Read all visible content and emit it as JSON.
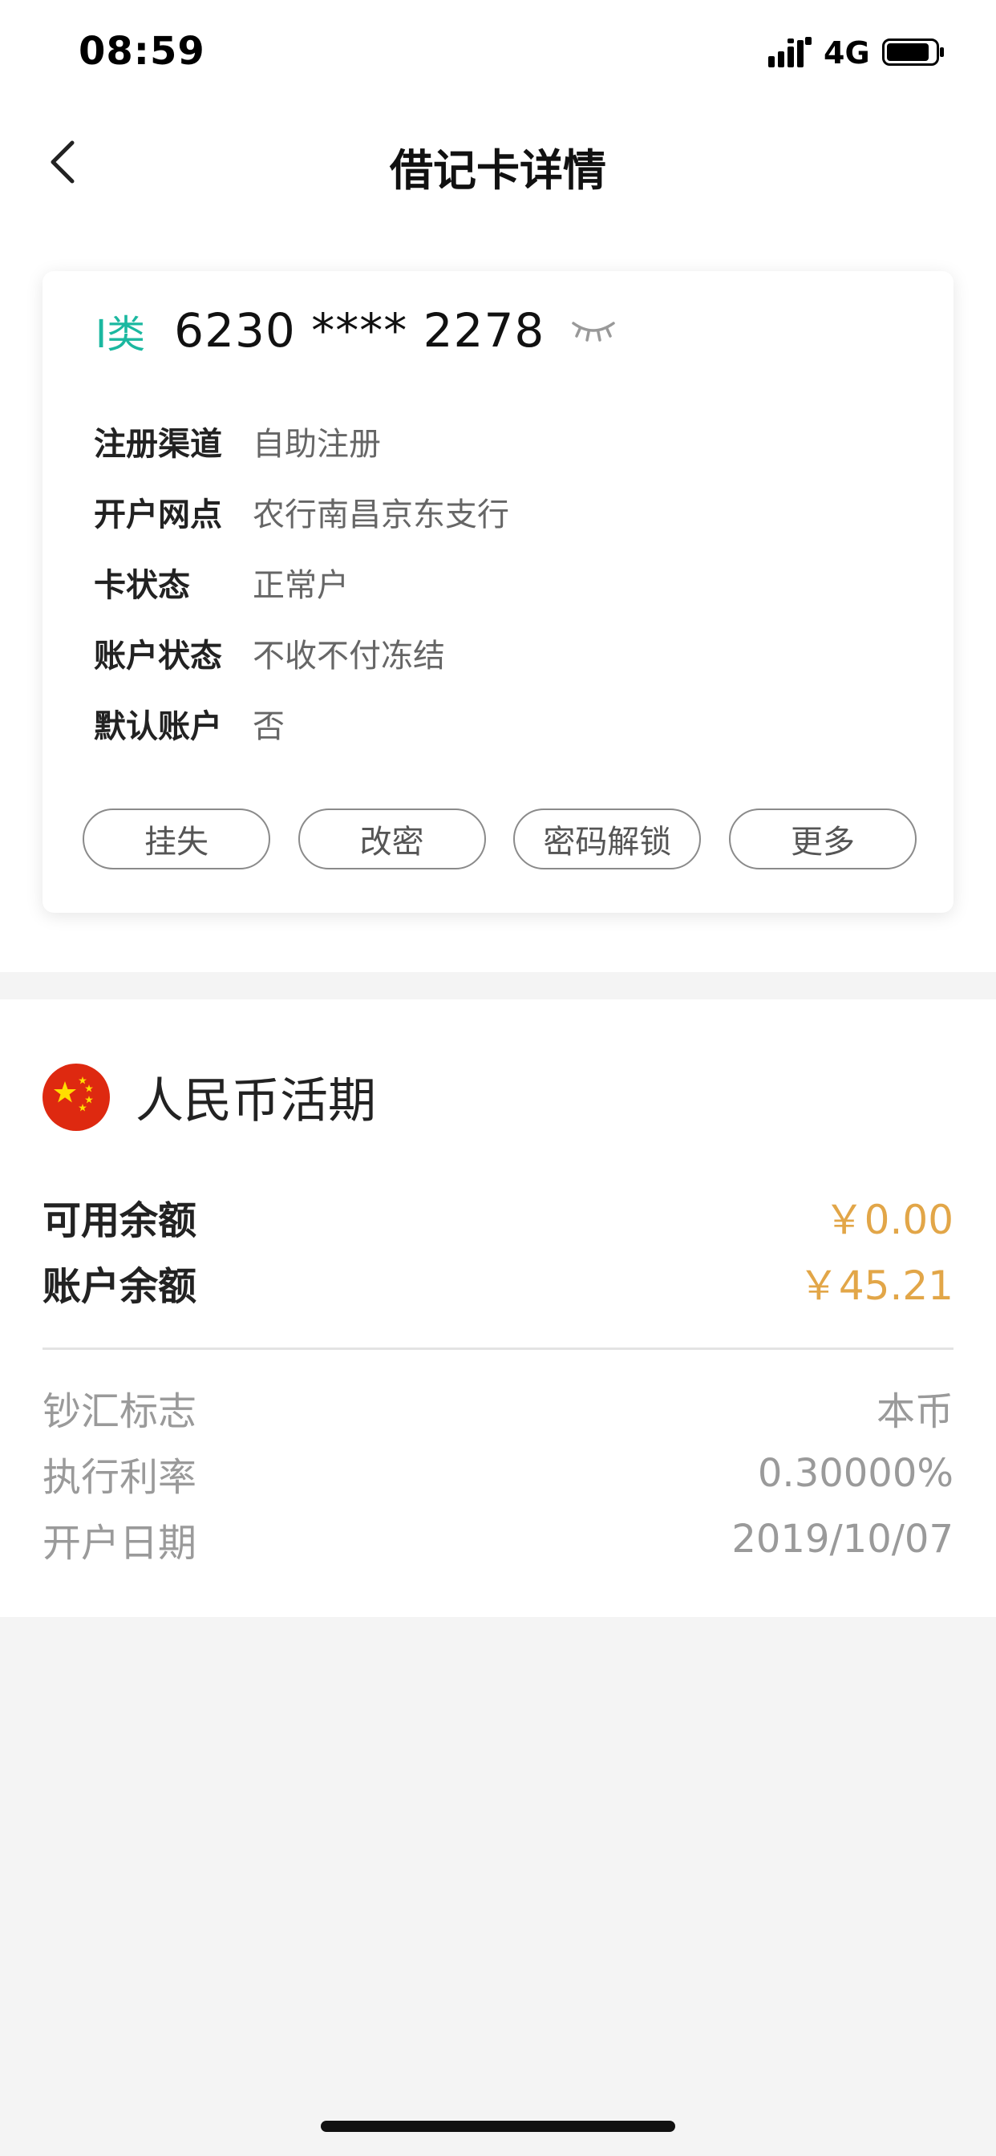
{
  "status_bar": {
    "time": "08:59",
    "network": "4G"
  },
  "nav": {
    "title": "借记卡详情",
    "back_icon": "chevron-left-icon"
  },
  "card": {
    "class_label": "I类",
    "number": "6230 **** 2278",
    "eye_icon": "eye-closed-icon",
    "info": [
      {
        "label": "注册渠道",
        "value": "自助注册"
      },
      {
        "label": "开户网点",
        "value": "农行南昌京东支行"
      },
      {
        "label": "卡状态",
        "value": "正常户"
      },
      {
        "label": "账户状态",
        "value": "不收不付冻结"
      },
      {
        "label": "默认账户",
        "value": "否"
      }
    ],
    "actions": [
      "挂失",
      "改密",
      "密码解锁",
      "更多"
    ]
  },
  "account": {
    "flag_icon": "china-flag-icon",
    "title": "人民币活期",
    "balances": [
      {
        "label": "可用余额",
        "value": "￥0.00"
      },
      {
        "label": "账户余额",
        "value": "￥45.21"
      }
    ],
    "meta": [
      {
        "label": "钞汇标志",
        "value": "本币"
      },
      {
        "label": "执行利率",
        "value": "0.30000%"
      },
      {
        "label": "开户日期",
        "value": "2019/10/07"
      }
    ]
  },
  "colors": {
    "accent_teal": "#1bb8a0",
    "amount_orange": "#e2a648",
    "background": "#f4f4f4"
  }
}
